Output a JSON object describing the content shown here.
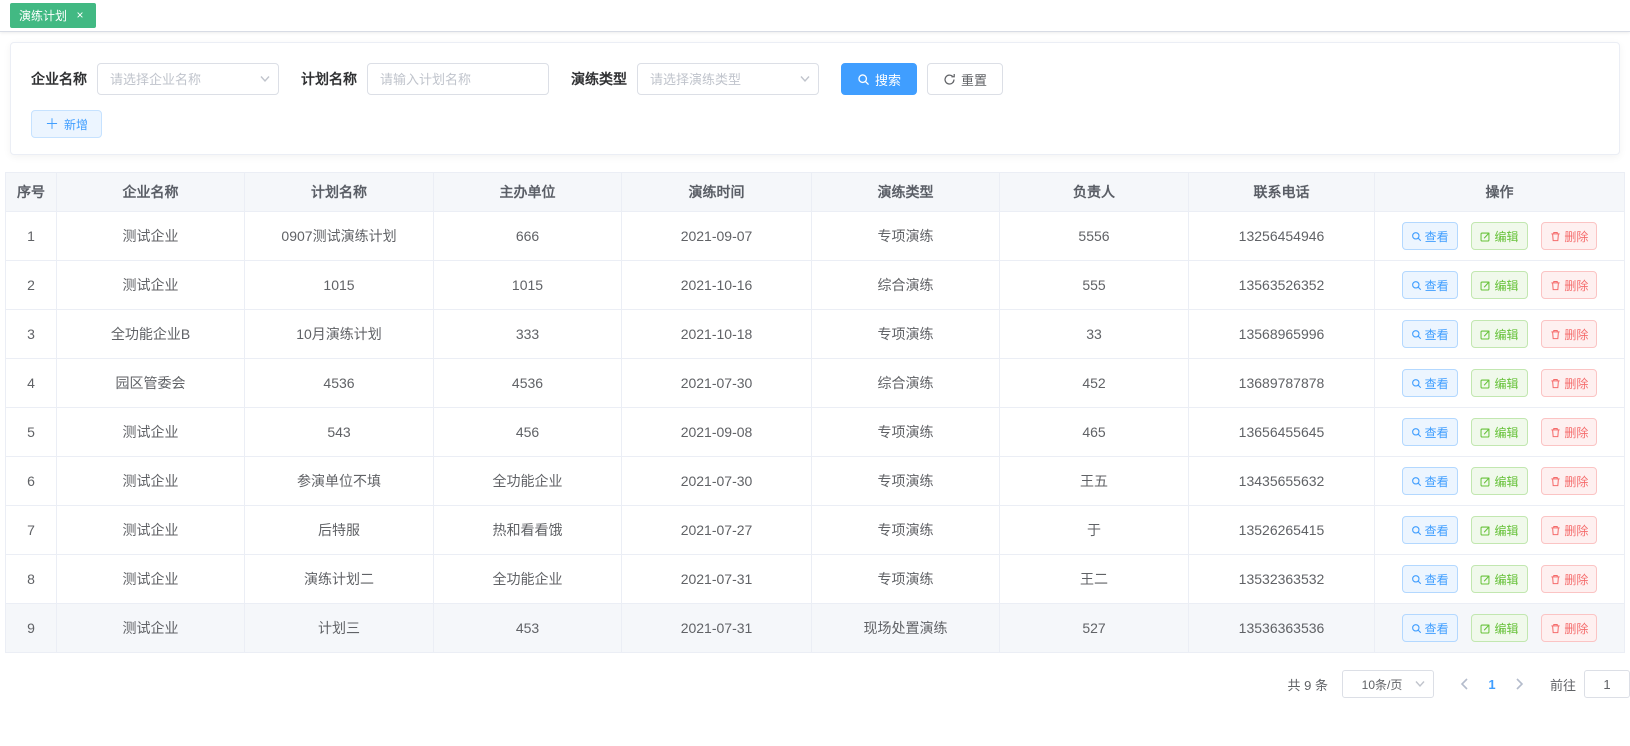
{
  "colors": {
    "primary": "#409eff",
    "success": "#67c23a",
    "danger": "#f56c6c",
    "tab_active_green": "#42b983",
    "table_border": "#ebeef5",
    "header_bg": "#f5f7fa"
  },
  "icons": {
    "close": "×",
    "plus": "＋"
  },
  "tabbar": {
    "tabs": [
      {
        "label": "演练计划",
        "active": true
      }
    ]
  },
  "filters": {
    "enterprise": {
      "label": "企业名称",
      "placeholder": "请选择企业名称"
    },
    "plan": {
      "label": "计划名称",
      "placeholder": "请输入计划名称"
    },
    "type": {
      "label": "演练类型",
      "placeholder": "请选择演练类型"
    },
    "search_label": "搜索",
    "reset_label": "重置",
    "add_label": "新增"
  },
  "table": {
    "columns": [
      "序号",
      "企业名称",
      "计划名称",
      "主办单位",
      "演练时间",
      "演练类型",
      "负责人",
      "联系电话",
      "操作"
    ],
    "actions": {
      "view": "查看",
      "edit": "编辑",
      "delete": "删除"
    },
    "rows": [
      {
        "no": "1",
        "enterprise": "测试企业",
        "plan": "0907测试演练计划",
        "host": "666",
        "time": "2021-09-07",
        "type": "专项演练",
        "leader": "5556",
        "phone": "13256454946",
        "highlighted": false
      },
      {
        "no": "2",
        "enterprise": "测试企业",
        "plan": "1015",
        "host": "1015",
        "time": "2021-10-16",
        "type": "综合演练",
        "leader": "555",
        "phone": "13563526352",
        "highlighted": false
      },
      {
        "no": "3",
        "enterprise": "全功能企业B",
        "plan": "10月演练计划",
        "host": "333",
        "time": "2021-10-18",
        "type": "专项演练",
        "leader": "33",
        "phone": "13568965996",
        "highlighted": false
      },
      {
        "no": "4",
        "enterprise": "园区管委会",
        "plan": "4536",
        "host": "4536",
        "time": "2021-07-30",
        "type": "综合演练",
        "leader": "452",
        "phone": "13689787878",
        "highlighted": false
      },
      {
        "no": "5",
        "enterprise": "测试企业",
        "plan": "543",
        "host": "456",
        "time": "2021-09-08",
        "type": "专项演练",
        "leader": "465",
        "phone": "13656455645",
        "highlighted": false
      },
      {
        "no": "6",
        "enterprise": "测试企业",
        "plan": "参演单位不填",
        "host": "全功能企业",
        "time": "2021-07-30",
        "type": "专项演练",
        "leader": "王五",
        "phone": "13435655632",
        "highlighted": false
      },
      {
        "no": "7",
        "enterprise": "测试企业",
        "plan": "后特服",
        "host": "热和看看饿",
        "time": "2021-07-27",
        "type": "专项演练",
        "leader": "于",
        "phone": "13526265415",
        "highlighted": false
      },
      {
        "no": "8",
        "enterprise": "测试企业",
        "plan": "演练计划二",
        "host": "全功能企业",
        "time": "2021-07-31",
        "type": "专项演练",
        "leader": "王二",
        "phone": "13532363532",
        "highlighted": false
      },
      {
        "no": "9",
        "enterprise": "测试企业",
        "plan": "计划三",
        "host": "453",
        "time": "2021-07-31",
        "type": "现场处置演练",
        "leader": "527",
        "phone": "13536363536",
        "highlighted": true
      }
    ]
  },
  "pagination": {
    "total_text": "共 9 条",
    "page_size": "10条/页",
    "current_page": "1",
    "goto_label": "前往",
    "goto_value": "1"
  }
}
